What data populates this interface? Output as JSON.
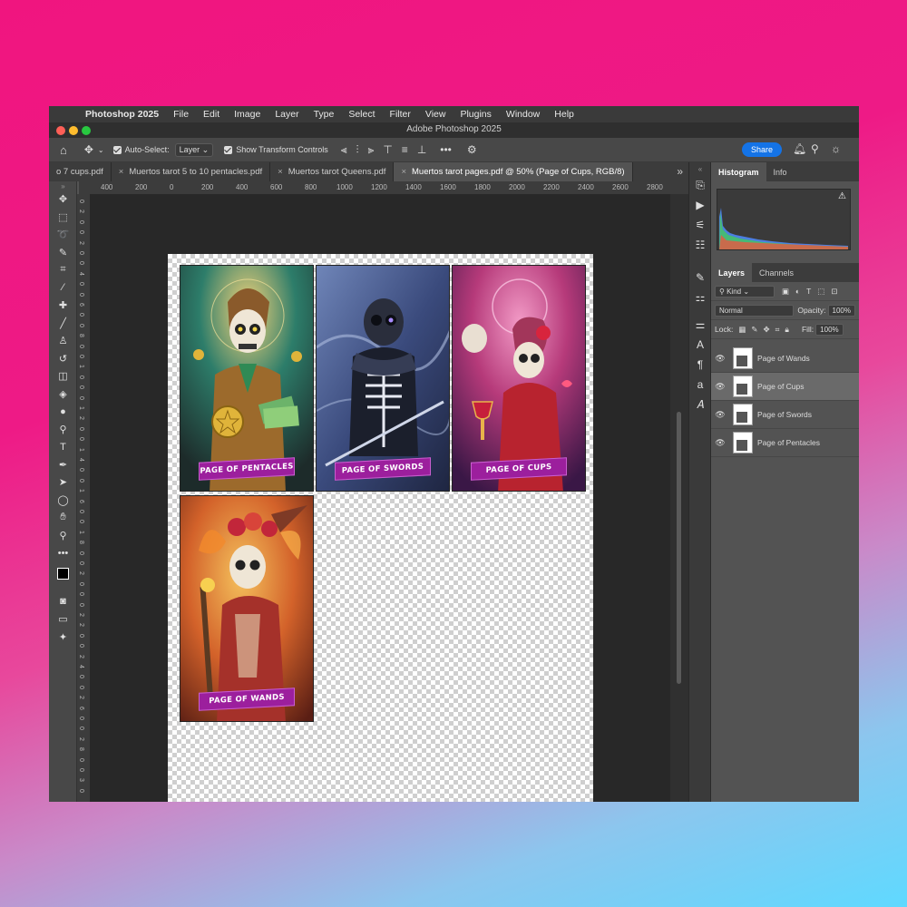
{
  "menubar": {
    "apple": "",
    "items": [
      "Photoshop 2025",
      "File",
      "Edit",
      "Image",
      "Layer",
      "Type",
      "Select",
      "Filter",
      "View",
      "Plugins",
      "Window",
      "Help"
    ]
  },
  "window": {
    "title": "Adobe Photoshop 2025"
  },
  "options": {
    "auto_select_label": "Auto-Select:",
    "auto_select_value": "Layer",
    "transform_label": "Show Transform Controls",
    "more": "•••",
    "share": "Share"
  },
  "tabs": [
    "o 7 cups.pdf",
    "Muertos  tarot 5 to 10 pentacles.pdf",
    "Muertos tarot Queens.pdf",
    "Muertos tarot pages.pdf @ 50% (Page of Cups, RGB/8)"
  ],
  "tabs_overflow": "»",
  "ruler_top": [
    "400",
    "200",
    "0",
    "200",
    "400",
    "600",
    "800",
    "1000",
    "1200",
    "1400",
    "1600",
    "1800",
    "2000",
    "2200",
    "2400",
    "2600",
    "2800"
  ],
  "ruler_left": [
    "0",
    "2",
    "0",
    "0",
    "2",
    "0",
    "0",
    "4",
    "0",
    "0",
    "6",
    "0",
    "0",
    "8",
    "0",
    "0",
    "1",
    "0",
    "0",
    "0",
    "1",
    "2",
    "0",
    "0",
    "1",
    "4",
    "0",
    "0",
    "1",
    "6",
    "0",
    "0",
    "1",
    "8",
    "0",
    "0",
    "2",
    "0",
    "0",
    "0",
    "2",
    "2",
    "0",
    "0",
    "2",
    "4",
    "0",
    "0",
    "2",
    "6",
    "0",
    "0",
    "2",
    "8",
    "0",
    "0",
    "3",
    "0"
  ],
  "cards": [
    {
      "label": "PAGE OF PENTACLES"
    },
    {
      "label": "PAGE OF SWORDS"
    },
    {
      "label": "PAGE OF CUPS"
    },
    {
      "label": "PAGE OF WANDS"
    }
  ],
  "panels": {
    "top_tabs": [
      "Histogram",
      "Info"
    ],
    "layer_tabs": [
      "Layers",
      "Channels"
    ],
    "kind": "Kind",
    "blend": "Normal",
    "opacity_label": "Opacity:",
    "opacity_value": "100%",
    "lock_label": "Lock:",
    "fill_label": "Fill:",
    "fill_value": "100%",
    "layers": [
      "Page of Wands",
      "Page of Cups",
      "Page of Swords",
      "Page of Pentacles"
    ],
    "selected_layer": "Page of Cups"
  },
  "colors": {
    "background_top": "#f0157f",
    "background_bottom": "#5fd9ff",
    "share_button": "#1473e6",
    "banner": "#9c1f9d"
  }
}
